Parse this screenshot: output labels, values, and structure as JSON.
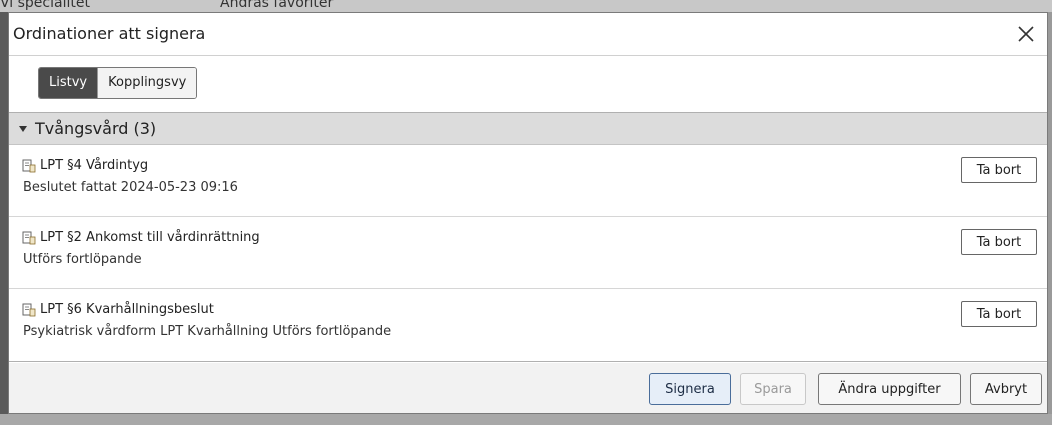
{
  "background": {
    "left_text": "Vi specialitet",
    "right_text": "Andras favoriter"
  },
  "dialog": {
    "title": "Ordinationer att signera",
    "close_icon": "close-icon"
  },
  "view_toggle": {
    "options": [
      {
        "label": "Listvy",
        "active": true
      },
      {
        "label": "Kopplingsvy",
        "active": false
      }
    ]
  },
  "group": {
    "label": "Tvångsvård (3)",
    "expanded": true
  },
  "items": [
    {
      "icon": "document-icon",
      "title": "LPT §4 Vårdintyg",
      "subtitle": "Beslutet fattat 2024-05-23 09:16",
      "remove_label": "Ta bort"
    },
    {
      "icon": "document-icon",
      "title": "LPT §2 Ankomst till vårdinrättning",
      "subtitle": "Utförs fortlöpande",
      "remove_label": "Ta bort"
    },
    {
      "icon": "document-icon",
      "title": "LPT §6 Kvarhållningsbeslut",
      "subtitle": "Psykiatrisk vårdform LPT Kvarhållning Utförs fortlöpande",
      "remove_label": "Ta bort"
    }
  ],
  "footer": {
    "sign_label": "Signera",
    "save_label": "Spara",
    "edit_label": "Ändra uppgifter",
    "cancel_label": "Avbryt"
  },
  "colors": {
    "primary_button_border": "#4a6d9a",
    "toggle_active_bg": "#4a4a4a",
    "group_header_bg": "#dcdcdc"
  }
}
